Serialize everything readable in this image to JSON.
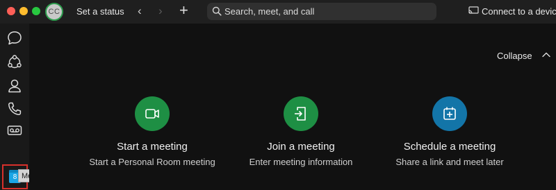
{
  "titlebar": {
    "avatar_initials": "CC",
    "status_label": "Set a status",
    "search_placeholder": "Search, meet, and call",
    "connect_label": "Connect to a device"
  },
  "sidebar": {
    "items": [
      {
        "name": "messaging",
        "icon": "chat-bubble-icon"
      },
      {
        "name": "teams",
        "icon": "teams-icon"
      },
      {
        "name": "contacts",
        "icon": "person-icon"
      },
      {
        "name": "calling",
        "icon": "phone-icon"
      },
      {
        "name": "voicemail",
        "icon": "voicemail-icon"
      },
      {
        "name": "meetings",
        "icon": "calendar-icon",
        "badge": "8",
        "selected": true
      }
    ],
    "tooltip": "Meetings"
  },
  "main": {
    "collapse_label": "Collapse",
    "actions": [
      {
        "title": "Start a meeting",
        "subtitle": "Start a Personal Room meeting",
        "icon": "video-camera-icon",
        "color": "#1e8f44"
      },
      {
        "title": "Join a meeting",
        "subtitle": "Enter meeting information",
        "icon": "join-door-icon",
        "color": "#1e8f44"
      },
      {
        "title": "Schedule a meeting",
        "subtitle": "Share a link and meet later",
        "icon": "calendar-add-icon",
        "color": "#1375a8"
      }
    ]
  },
  "colors": {
    "window_bg": "#111111",
    "titlebar_bg": "#1f1f1f",
    "selection_frame": "#d8302b",
    "badge_blue": "#1aa6e6",
    "green": "#1e8f44",
    "blue": "#1375a8"
  }
}
